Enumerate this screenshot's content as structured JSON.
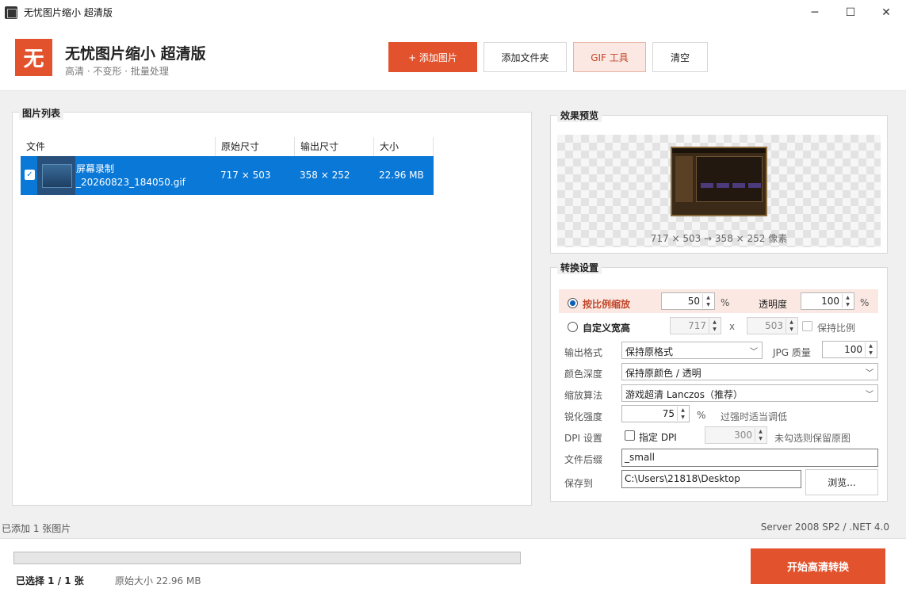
{
  "window": {
    "title": "无忧图片缩小 超清版",
    "controls": {
      "minimize": "─",
      "maximize": "☐",
      "close": "✕"
    }
  },
  "header": {
    "logo_char": "无",
    "app_title": "无忧图片缩小 超清版",
    "app_subtitle": "高清 · 不变形 · 批量处理",
    "buttons": {
      "add_image": "+   添加图片",
      "add_folder": "添加文件夹",
      "gif_tool": "GIF 工具",
      "clear": "清空"
    },
    "accent_color": "#e2532d"
  },
  "image_list": {
    "group_label": "图片列表",
    "columns": [
      "文件",
      "原始尺寸",
      "输出尺寸",
      "大小"
    ],
    "rows": [
      {
        "checked": true,
        "name_line1": "屏幕录制",
        "name_line2": "_20260823_184050.gif",
        "original_size": "717 × 503",
        "output_size": "358 × 252",
        "file_size": "22.96 MB"
      }
    ],
    "selection_color": "#0a78d7"
  },
  "preview": {
    "group_label": "效果预览",
    "caption": "717 × 503  →  358 × 252 像素"
  },
  "settings": {
    "group_label": "转换设置",
    "scale_mode": {
      "label": "按比例缩放",
      "selected": true,
      "value": "50",
      "unit": "%"
    },
    "opacity": {
      "label": "透明度",
      "value": "100",
      "unit": "%"
    },
    "custom_size": {
      "label": "自定义宽高",
      "selected": false,
      "width": "717",
      "separator": "x",
      "height": "503",
      "keep_ratio_label": "保持比例",
      "keep_ratio_checked": false
    },
    "output_format": {
      "label": "输出格式",
      "value": "保持原格式"
    },
    "jpg_quality": {
      "label": "JPG 质量",
      "value": "100"
    },
    "color_depth": {
      "label": "颜色深度",
      "value": "保持原颜色 / 透明"
    },
    "scale_algorithm": {
      "label": "缩放算法",
      "value": "游戏超清 Lanczos（推荐）"
    },
    "sharpen": {
      "label": "锐化强度",
      "value": "75",
      "unit": "%",
      "hint": "过强时适当调低"
    },
    "dpi": {
      "label": "DPI 设置",
      "checkbox_label": "指定 DPI",
      "checked": false,
      "value": "300",
      "hint": "未勾选则保留原图"
    },
    "suffix": {
      "label": "文件后缀",
      "value": "_small"
    },
    "save_to": {
      "label": "保存到",
      "value": "C:\\Users\\21818\\Desktop",
      "browse_label": "浏览..."
    }
  },
  "status": {
    "left": "已添加 1 张图片",
    "right": "Server 2008 SP2 / .NET 4.0"
  },
  "footer": {
    "progress": 0,
    "selected_text": "已选择 1 / 1 张",
    "original_total": "原始大小 22.96 MB",
    "convert_button": "开始高清转换"
  }
}
